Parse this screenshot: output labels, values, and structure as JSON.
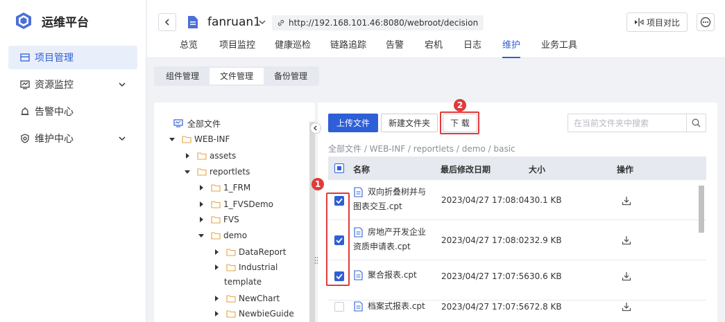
{
  "app": {
    "title": "运维平台"
  },
  "sidebar": {
    "items": [
      {
        "label": "项目管理",
        "icon": "project-icon",
        "active": true
      },
      {
        "label": "资源监控",
        "icon": "monitor-icon",
        "expandable": true
      },
      {
        "label": "告警中心",
        "icon": "alarm-icon"
      },
      {
        "label": "维护中心",
        "icon": "maintenance-icon",
        "expandable": true
      }
    ]
  },
  "header": {
    "project_name": "fanruan1",
    "url": "http://192.168.101.46:8080/webroot/decision",
    "compare_label": "项目对比",
    "tabs": [
      {
        "label": "总览"
      },
      {
        "label": "项目监控"
      },
      {
        "label": "健康巡检"
      },
      {
        "label": "链路追踪"
      },
      {
        "label": "告警"
      },
      {
        "label": "宕机"
      },
      {
        "label": "日志"
      },
      {
        "label": "维护",
        "active": true
      },
      {
        "label": "业务工具"
      }
    ]
  },
  "subtabs": [
    {
      "label": "组件管理"
    },
    {
      "label": "文件管理",
      "active": true
    },
    {
      "label": "备份管理"
    }
  ],
  "tree": {
    "root": "全部文件",
    "nodes": [
      {
        "label": "WEB-INF",
        "expanded": true
      },
      {
        "label": "assets",
        "expanded": false
      },
      {
        "label": "reportlets",
        "expanded": true
      },
      {
        "label": "1_FRM",
        "expanded": false
      },
      {
        "label": "1_FVSDemo",
        "expanded": false
      },
      {
        "label": "FVS",
        "expanded": false
      },
      {
        "label": "demo",
        "expanded": true
      },
      {
        "label": "DataReport",
        "expanded": false
      },
      {
        "label": "Industrial",
        "label_line2": "template",
        "expanded": false
      },
      {
        "label": "NewChart",
        "expanded": false
      },
      {
        "label": "NewbieGuide",
        "expanded": false
      }
    ]
  },
  "toolbar": {
    "upload_label": "上传文件",
    "new_folder_label": "新建文件夹",
    "download_label": "下 载",
    "search_placeholder": "在当前文件夹中搜索"
  },
  "annotations": {
    "step1": "1",
    "step2": "2",
    "highlight_color": "#e03a3a"
  },
  "breadcrumb": "全部文件 / WEB-INF / reportlets / demo / basic",
  "table": {
    "headers": {
      "name": "名称",
      "modified": "最后修改日期",
      "size": "大小",
      "actions": "操作"
    },
    "rows": [
      {
        "name_line1": "双向折叠树并与",
        "name_line2": "图表交互.cpt",
        "modified": "2023/04/27 17:08:04",
        "size": "30.1 KB",
        "checked": true
      },
      {
        "name_line1": "房地产开发企业",
        "name_line2": "资质申请表.cpt",
        "modified": "2023/04/27 17:08:02",
        "size": "32.9 KB",
        "checked": true
      },
      {
        "name_line1": "聚合报表.cpt",
        "name_line2": "",
        "modified": "2023/04/27 17:07:56",
        "size": "30.6 KB",
        "checked": true
      },
      {
        "name_line1": "档案式报表.cpt",
        "name_line2": "",
        "modified": "2023/04/27 17:07:56",
        "size": "72.8 KB",
        "checked": false
      }
    ]
  },
  "colors": {
    "accent": "#2f5fd6",
    "annotation": "#e03a3a"
  }
}
